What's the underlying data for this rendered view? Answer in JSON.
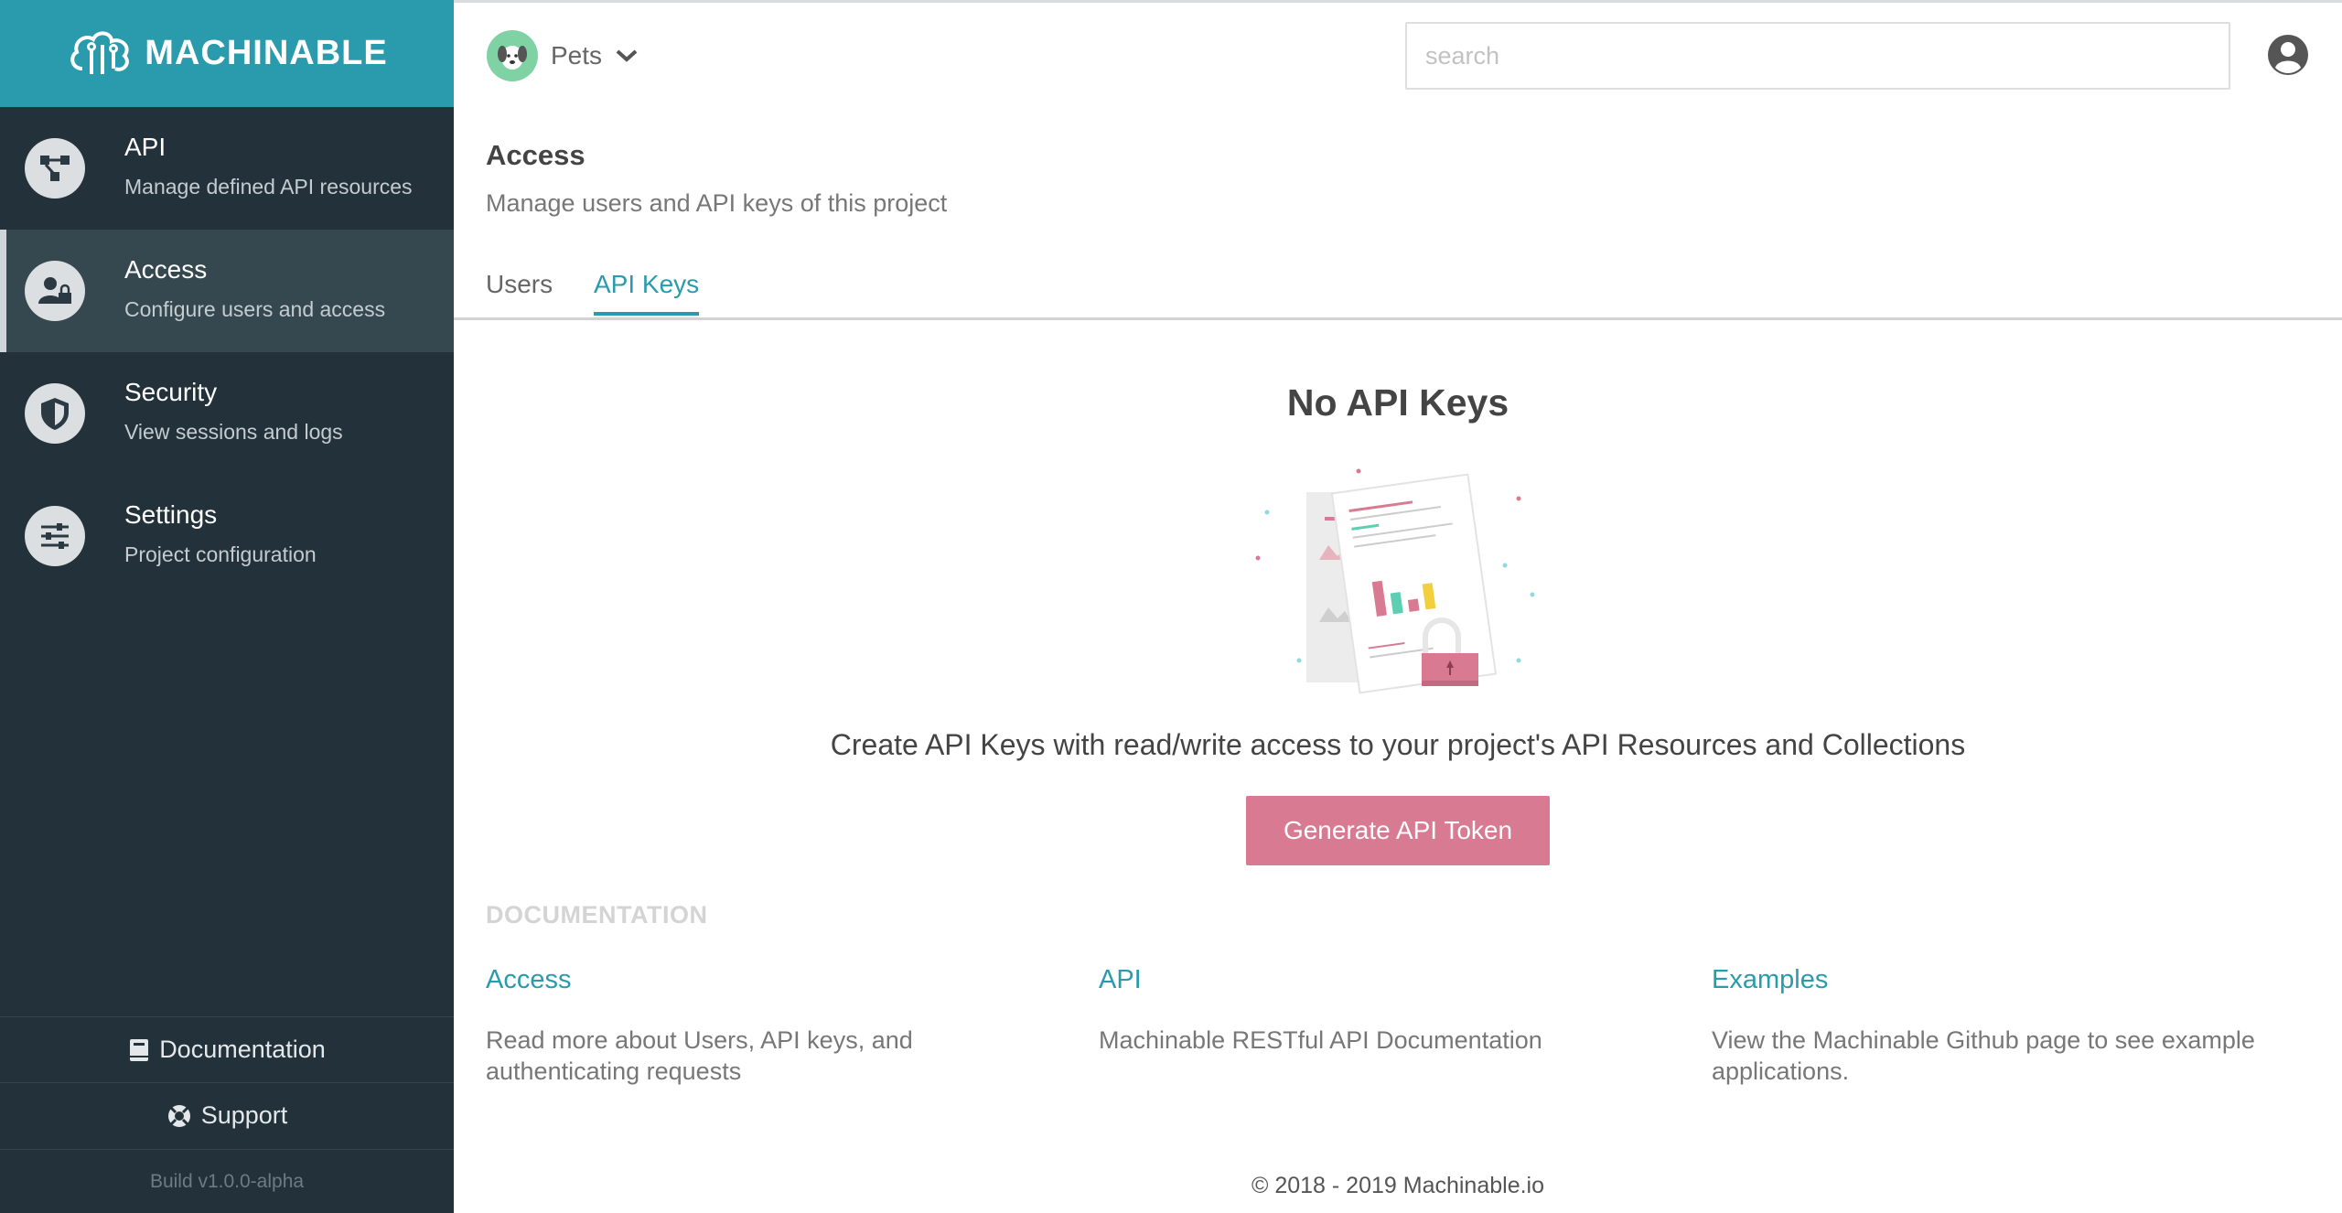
{
  "sidebar": {
    "logo": "MACHINABLE",
    "items": [
      {
        "title": "API",
        "subtitle": "Manage defined API resources",
        "icon": "api-nodes-icon"
      },
      {
        "title": "Access",
        "subtitle": "Configure users and access",
        "icon": "user-lock-icon"
      },
      {
        "title": "Security",
        "subtitle": "View sessions and logs",
        "icon": "shield-icon"
      },
      {
        "title": "Settings",
        "subtitle": "Project configuration",
        "icon": "sliders-icon"
      }
    ],
    "active_item": "Access",
    "documentation_label": "Documentation",
    "support_label": "Support",
    "build": "Build v1.0.0-alpha"
  },
  "topbar": {
    "project_name": "Pets",
    "search_placeholder": "search"
  },
  "header": {
    "title": "Access",
    "subtitle": "Manage users and API keys of this project"
  },
  "tabs": [
    {
      "label": "Users",
      "active": false
    },
    {
      "label": "API Keys",
      "active": true
    }
  ],
  "empty_state": {
    "title": "No API Keys",
    "description": "Create API Keys with read/write access to your project's API Resources and Collections",
    "button_label": "Generate API Token"
  },
  "documentation": {
    "heading": "DOCUMENTATION",
    "links": [
      {
        "title": "Access",
        "description": "Read more about Users, API keys, and authenticating requests"
      },
      {
        "title": "API",
        "description": "Machinable RESTful API Documentation"
      },
      {
        "title": "Examples",
        "description": "View the Machinable Github page to see example applications."
      }
    ]
  },
  "footer": {
    "copyright": "© 2018 - 2019 Machinable.io"
  },
  "colors": {
    "brand": "#2a9bad",
    "sidebar_bg": "#22313a",
    "button": "#d87b92"
  }
}
